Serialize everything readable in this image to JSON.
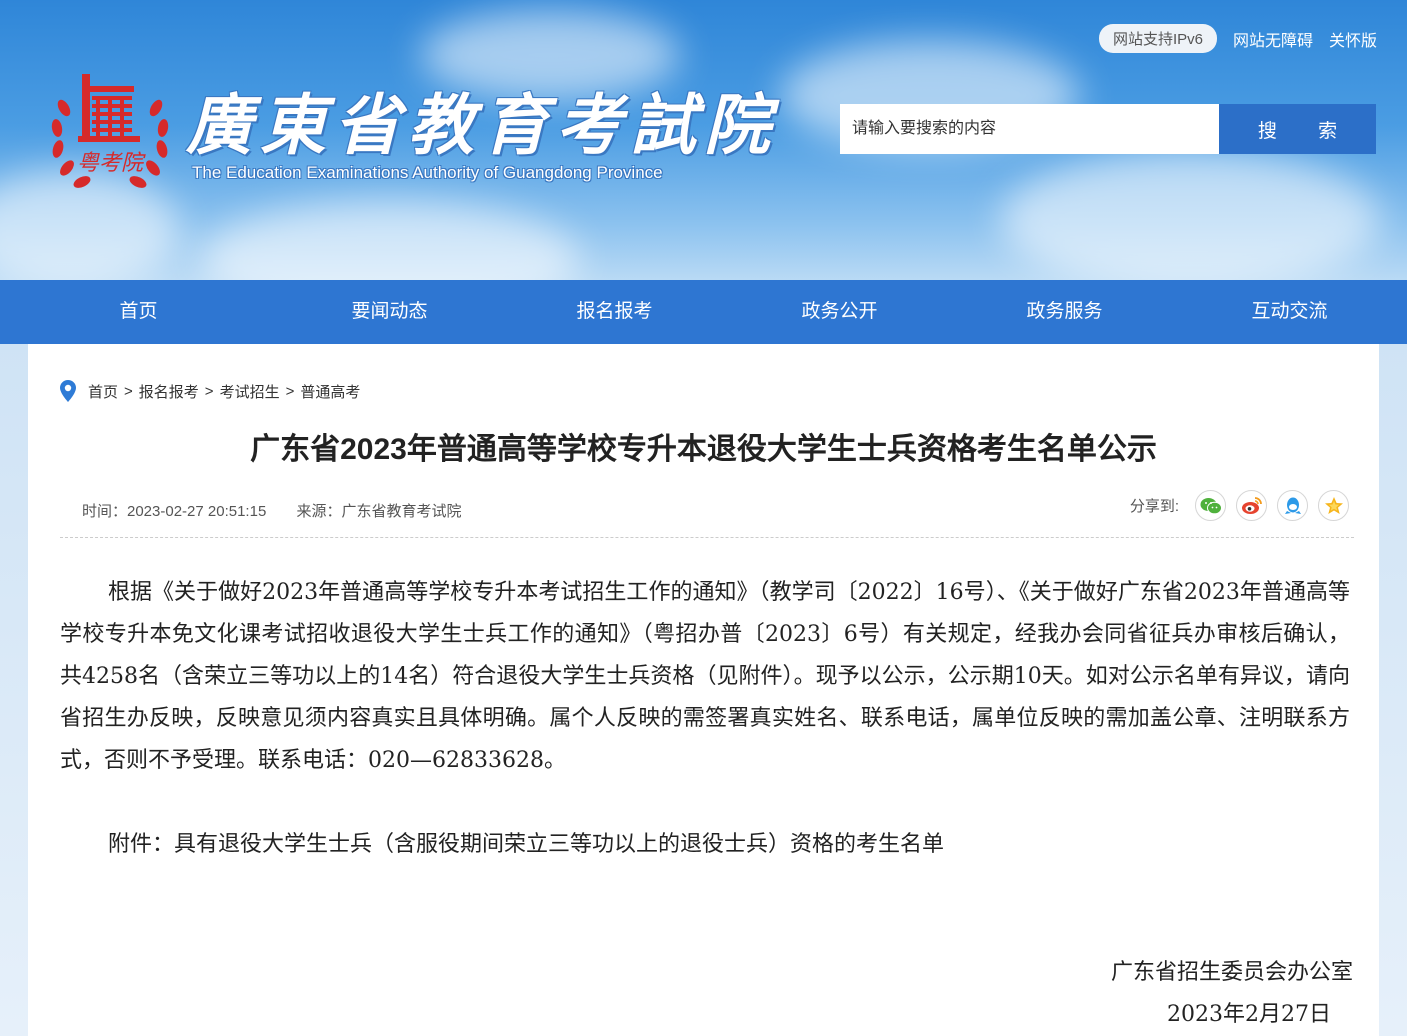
{
  "header": {
    "ipv6_label": "网站支持IPv6",
    "accessibility_link": "网站无障碍",
    "elder_link": "关怀版",
    "logo_title": "廣東省教育考試院",
    "logo_subtitle": "The Education Examinations Authority of Guangdong Province",
    "logo_seal_text": "粤考院",
    "search": {
      "placeholder": "请输入要搜索的内容",
      "button_label": "搜 索"
    }
  },
  "nav": {
    "items": [
      "首页",
      "要闻动态",
      "报名报考",
      "政务公开",
      "政务服务",
      "互动交流"
    ]
  },
  "breadcrumb": {
    "items": [
      "首页",
      "报名报考",
      "考试招生",
      "普通高考"
    ],
    "separator": ">"
  },
  "article": {
    "title": "广东省2023年普通高等学校专升本退役大学生士兵资格考生名单公示",
    "time": "时间：2023-02-27 20:51:15",
    "source": "来源：广东省教育考试院",
    "share_label": "分享到:",
    "share_icons": [
      "wechat-icon",
      "weibo-icon",
      "qq-icon",
      "qzone-icon"
    ],
    "body": "根据《关于做好2023年普通高等学校专升本考试招生工作的通知》（教学司〔2022〕16号）、《关于做好广东省2023年普通高等学校专升本免文化课考试招收退役大学生士兵工作的通知》（粤招办普〔2023〕6号）有关规定，经我办会同省征兵办审核后确认，共4258名（含荣立三等功以上的14名）符合退役大学生士兵资格（见附件）。现予以公示，公示期10天。如对公示名单有异议，请向省招生办反映，反映意见须内容真实且具体明确。属个人反映的需签署真实姓名、联系电话，属单位反映的需加盖公章、注明联系方式，否则不予受理。联系电话：020—62833628。",
    "attachment": "附件：具有退役大学生士兵（含服役期间荣立三等功以上的退役士兵）资格的考生名单",
    "signer": "广东省招生委员会办公室",
    "date": "2023年2月27日"
  },
  "colors": {
    "nav_bg": "#2e76d2",
    "search_button": "#2c6fc8",
    "emblem_red": "#d62a2a"
  }
}
